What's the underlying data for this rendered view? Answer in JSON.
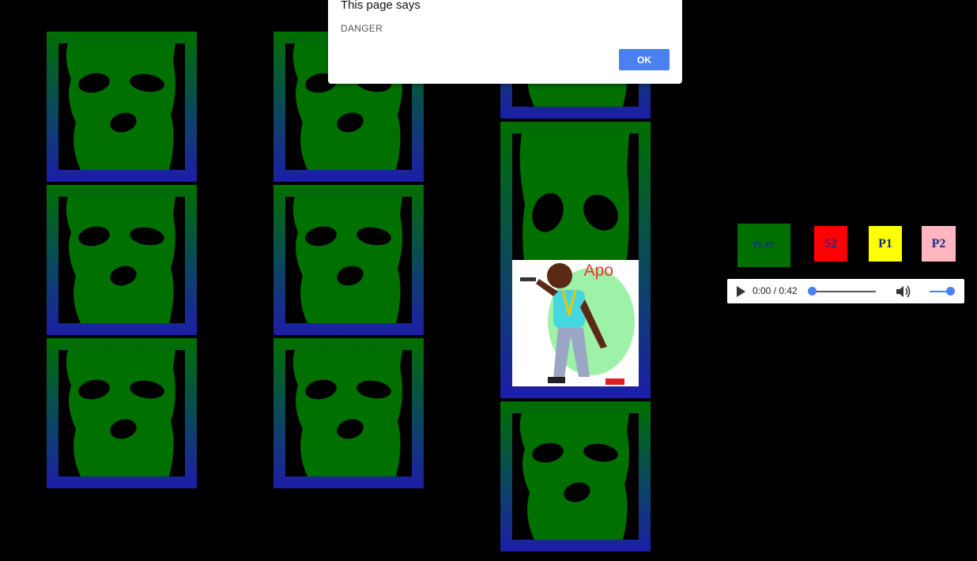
{
  "dialog": {
    "title": "This page says",
    "message": "DANGER",
    "ok_label": "OK"
  },
  "controls": {
    "play_label": "PLAY",
    "btn_52_label": "52",
    "btn_p1_label": "P1",
    "btn_p2_label": "P2",
    "colors": {
      "play": "#007000",
      "b52": "#ff0000",
      "p1": "#ffff00",
      "p2": "#ffb6c1"
    }
  },
  "audio": {
    "time": "0:00 / 0:42",
    "progress": 0,
    "volume": 1.0,
    "icons": [
      "play-icon",
      "volume-icon"
    ]
  },
  "grid": {
    "mask_color": "#007000",
    "tile_count": 10,
    "revealed_card_label": "Apo"
  }
}
